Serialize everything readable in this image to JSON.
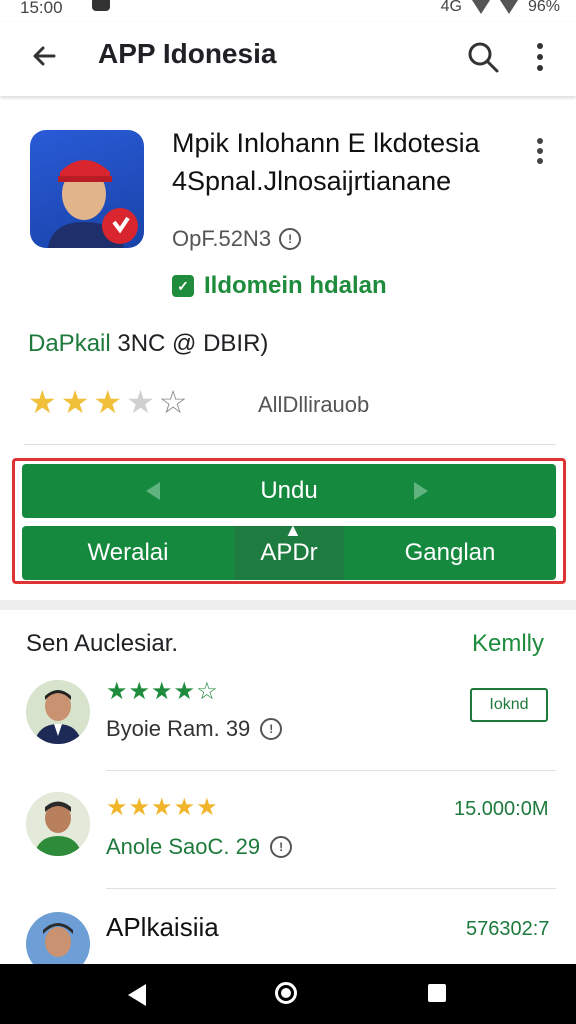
{
  "status": {
    "time": "15:00",
    "battery": "96%",
    "network": "4G"
  },
  "topbar": {
    "title": "APP Idonesia",
    "back_icon": "arrow-back-icon",
    "search_icon": "search-icon",
    "more_icon": "more-vert-icon"
  },
  "app": {
    "title": "Mpik Inlohann E lkdotesia",
    "subtitle": "4Spnal.Jlnosaijrtianane",
    "size": "OpF.52N3",
    "verified_label": "Ildomein hdalan",
    "developer_highlight": "DaPkail",
    "developer_rest": " 3NC @ DBIR)",
    "rating": 3,
    "rating_max": 5,
    "rating_text": "AllDllirauob"
  },
  "actions": {
    "primary": "Undu",
    "left": "Weralai",
    "middle": "APDr",
    "right": "Ganglan"
  },
  "section": {
    "title": "Sen Auclesiar.",
    "link": "Kemlly",
    "items": [
      {
        "stars": "★★★★☆",
        "name": "Byoie Ram. 39",
        "right": "Ioknd"
      },
      {
        "stars": "★★★★★",
        "name": "Anole SaoC. 29",
        "right": "15.000:0M"
      },
      {
        "stars": "",
        "title": "APlkaisiia",
        "right": "576302:7"
      }
    ]
  },
  "colors": {
    "accent": "#158a3e",
    "highlight_border": "#d33333",
    "star": "#f0c03a"
  }
}
